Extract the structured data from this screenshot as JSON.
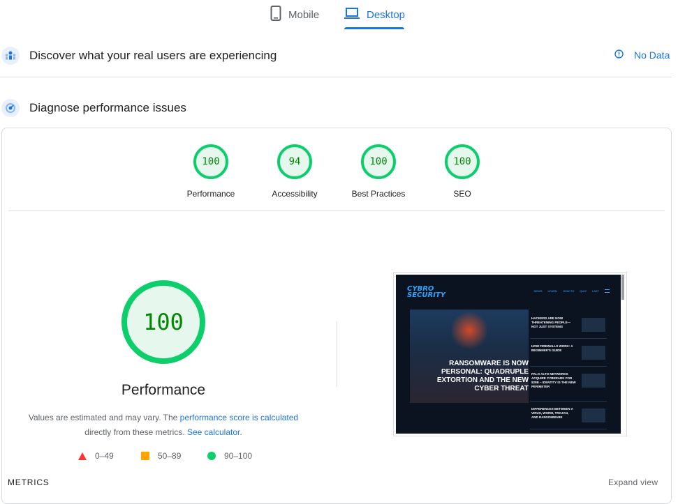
{
  "tabs": [
    {
      "label": "Mobile",
      "icon": "phone-icon",
      "active": false
    },
    {
      "label": "Desktop",
      "icon": "laptop-icon",
      "active": true
    }
  ],
  "field_data": {
    "title": "Discover what your real users are experiencing",
    "status": "No Data",
    "status_icon": "info-icon"
  },
  "lab": {
    "title": "Diagnose performance issues"
  },
  "categories": [
    {
      "score": "100",
      "label": "Performance"
    },
    {
      "score": "94",
      "label": "Accessibility"
    },
    {
      "score": "100",
      "label": "Best Practices"
    },
    {
      "score": "100",
      "label": "SEO"
    }
  ],
  "main_score": {
    "score": "100",
    "label": "Performance"
  },
  "description": {
    "part1": "Values are estimated and may vary. The ",
    "link1": "performance score is calculated",
    "part2": "directly from these metrics. ",
    "link2": "See calculator."
  },
  "legend": [
    {
      "range": "0–49",
      "shape": "triangle",
      "color": "#ff3333"
    },
    {
      "range": "50–89",
      "shape": "square",
      "color": "#ffa400"
    },
    {
      "range": "90–100",
      "shape": "circle",
      "color": "#0cce6b"
    }
  ],
  "screenshot": {
    "logo": "CYBRO SECURITY",
    "nav": [
      "NEWS",
      "LEARN",
      "HOW-TO",
      "QUIZ",
      "LAST"
    ],
    "headline": "RANSOMWARE IS NOW PERSONAL: QUADRUPLE EXTORTION AND THE NEW CYBER THREAT",
    "side_items": [
      "HACKERS ARE NOW THREATENING PEOPLE—NOT JUST SYSTEMS",
      "HOW FIREWALLS WORK: A BEGINNER'S GUIDE",
      "PALO ALTO NETWORKS ACQUIRE CYBERARK FOR $25B – IDENTITY IS THE NEW PERIMETER",
      "DIFFERENCES BETWEEN A VIRUS, WORM, TROJAN, AND RANSOMWARE"
    ]
  },
  "metrics": {
    "label": "METRICS",
    "expand": "Expand view"
  },
  "colors": {
    "accent": "#1a73e8",
    "pass": "#0cce6b",
    "pass_text": "#008800"
  }
}
